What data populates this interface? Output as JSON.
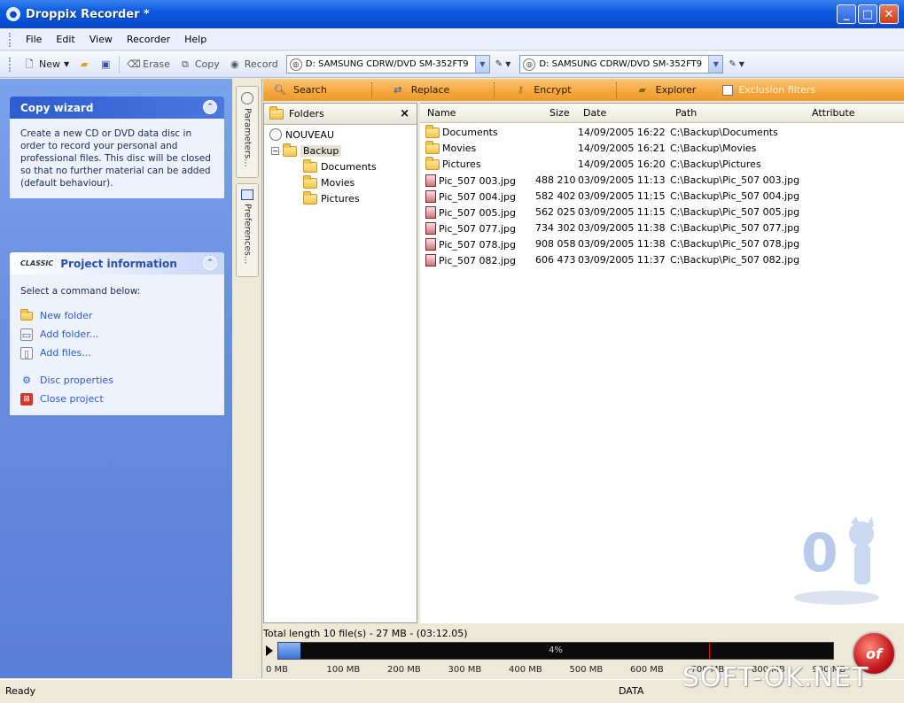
{
  "window": {
    "title": "Droppix Recorder *",
    "minimize": "_",
    "maximize": "□",
    "close": "✕"
  },
  "menu": [
    "File",
    "Edit",
    "View",
    "Recorder",
    "Help"
  ],
  "toolbar": {
    "new": "New",
    "erase": "Erase",
    "copy": "Copy",
    "record": "Record",
    "drive1": "D: SAMSUNG CDRW/DVD SM-352FT9",
    "drive2": "D: SAMSUNG CDRW/DVD SM-352FT9"
  },
  "wizard": {
    "title": "Copy wizard",
    "text": "Create a new CD or DVD data disc in order to record your personal and professional files. This disc will be closed so that no further material can be added (default behaviour)."
  },
  "project": {
    "title": "Project information",
    "logo_text": "CLASSIC",
    "prompt": "Select a command below:",
    "commands": [
      "New folder",
      "Add folder...",
      "Add files...",
      "Disc properties",
      "Close project"
    ]
  },
  "side_tabs": [
    "Parameters...",
    "Preferences..."
  ],
  "actions": {
    "search": "Search",
    "replace": "Replace",
    "encrypt": "Encrypt",
    "explorer": "Explorer",
    "exclusion": "Exclusion filters"
  },
  "folders_pane": {
    "title": "Folders",
    "close": "×",
    "root": "NOUVEAU",
    "backup": "Backup",
    "children": [
      "Documents",
      "Movies",
      "Pictures"
    ]
  },
  "file_list": {
    "columns": {
      "name": "Name",
      "size": "Size",
      "date": "Date",
      "path": "Path",
      "attribute": "Attribute"
    },
    "rows": [
      {
        "name": "Documents",
        "size": "",
        "date": "14/09/2005 16:22",
        "path": "C:\\Backup\\Documents",
        "type": "folder"
      },
      {
        "name": "Movies",
        "size": "",
        "date": "14/09/2005 16:21",
        "path": "C:\\Backup\\Movies",
        "type": "folder"
      },
      {
        "name": "Pictures",
        "size": "",
        "date": "14/09/2005 16:20",
        "path": "C:\\Backup\\Pictures",
        "type": "folder"
      },
      {
        "name": "Pic_507 003.jpg",
        "size": "488 210",
        "date": "03/09/2005 11:13",
        "path": "C:\\Backup\\Pic_507 003.jpg",
        "type": "file"
      },
      {
        "name": "Pic_507 004.jpg",
        "size": "582 402",
        "date": "03/09/2005 11:15",
        "path": "C:\\Backup\\Pic_507 004.jpg",
        "type": "file"
      },
      {
        "name": "Pic_507 005.jpg",
        "size": "562 025",
        "date": "03/09/2005 11:15",
        "path": "C:\\Backup\\Pic_507 005.jpg",
        "type": "file"
      },
      {
        "name": "Pic_507 077.jpg",
        "size": "734 302",
        "date": "03/09/2005 11:38",
        "path": "C:\\Backup\\Pic_507 077.jpg",
        "type": "file"
      },
      {
        "name": "Pic_507 078.jpg",
        "size": "908 058",
        "date": "03/09/2005 11:38",
        "path": "C:\\Backup\\Pic_507 078.jpg",
        "type": "file"
      },
      {
        "name": "Pic_507 082.jpg",
        "size": "606 473",
        "date": "03/09/2005 11:37",
        "path": "C:\\Backup\\Pic_507 082.jpg",
        "type": "file"
      }
    ]
  },
  "capacity": {
    "total": "Total length 10 file(s) - 27 MB - (03:12.05)",
    "percent_label": "4%",
    "fill_fraction": 0.04,
    "scale": [
      "0 MB",
      "100 MB",
      "200 MB",
      "300 MB",
      "400 MB",
      "500 MB",
      "600 MB",
      "700 MB",
      "800 MB",
      "900 MB"
    ]
  },
  "status": {
    "left": "Ready",
    "mid": "DATA"
  },
  "watermark": "SOFT-OK.NET",
  "colors": {
    "titlebar": "#0a4fd2",
    "action_bar": "#f5a53b",
    "panel": "#6a8fe0",
    "link": "#2a5bd7"
  }
}
